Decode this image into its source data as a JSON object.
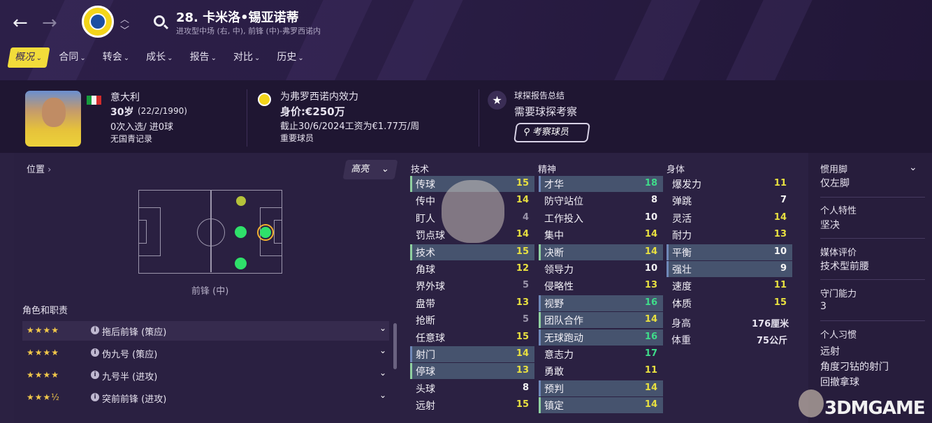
{
  "header": {
    "back_icon": "←",
    "forward_icon": "→",
    "player_number_name": "28. 卡米洛•锡亚诺蒂",
    "player_subtitle": "进攻型中场 (右, 中), 前锋 (中)-弗罗西诺内"
  },
  "tabs": [
    {
      "label": "概况"
    },
    {
      "label": "合同"
    },
    {
      "label": "转会"
    },
    {
      "label": "成长"
    },
    {
      "label": "报告"
    },
    {
      "label": "对比"
    },
    {
      "label": "历史"
    }
  ],
  "profile": {
    "nationality": "意大利",
    "age_label": "30岁",
    "birthdate": "(22/2/1990)",
    "caps": "0次入选/ 进0球",
    "youth_record": "无国青记录",
    "club_line": "为弗罗西诺内效力",
    "value": "身价:€250万",
    "contract": "截止30/6/2024工资为€1.77万/周",
    "squad_status": "重要球员",
    "scout_summary_title": "球探报告总结",
    "scout_summary_text": "需要球探考察",
    "scout_button": "考察球员"
  },
  "position": {
    "label": "位置",
    "highlight_btn": "高亮",
    "position_name": "前锋 (中)",
    "colors": {
      "natural": "#2fe06a",
      "accomplished": "#b5c23a",
      "selected_ring": "#f2b030"
    }
  },
  "roles": {
    "title": "角色和职责",
    "items": [
      {
        "stars": "★★★★",
        "name": "拖后前锋 (策应)"
      },
      {
        "stars": "★★★★",
        "name": "伪九号 (策应)"
      },
      {
        "stars": "★★★★",
        "name": "九号半 (进攻)"
      },
      {
        "stars": "★★★½",
        "name": "突前前锋 (进攻)"
      }
    ]
  },
  "technical": {
    "title": "技术",
    "items": [
      {
        "name": "传球",
        "value": "15"
      },
      {
        "name": "传中",
        "value": "14"
      },
      {
        "name": "盯人",
        "value": "4"
      },
      {
        "name": "罚点球",
        "value": "14"
      },
      {
        "name": "技术",
        "value": "15"
      },
      {
        "name": "角球",
        "value": "12"
      },
      {
        "name": "界外球",
        "value": "5"
      },
      {
        "name": "盘带",
        "value": "13"
      },
      {
        "name": "抢断",
        "value": "5"
      },
      {
        "name": "任意球",
        "value": "15"
      },
      {
        "name": "射门",
        "value": "14"
      },
      {
        "name": "停球",
        "value": "13"
      },
      {
        "name": "头球",
        "value": "8"
      },
      {
        "name": "远射",
        "value": "15"
      }
    ]
  },
  "mental": {
    "title": "精神",
    "items": [
      {
        "name": "才华",
        "value": "18"
      },
      {
        "name": "防守站位",
        "value": "8"
      },
      {
        "name": "工作投入",
        "value": "10"
      },
      {
        "name": "集中",
        "value": "14"
      },
      {
        "name": "决断",
        "value": "14"
      },
      {
        "name": "领导力",
        "value": "10"
      },
      {
        "name": "侵略性",
        "value": "13"
      },
      {
        "name": "视野",
        "value": "16"
      },
      {
        "name": "团队合作",
        "value": "14"
      },
      {
        "name": "无球跑动",
        "value": "16"
      },
      {
        "name": "意志力",
        "value": "17"
      },
      {
        "name": "勇敢",
        "value": "11"
      },
      {
        "name": "预判",
        "value": "14"
      },
      {
        "name": "镇定",
        "value": "14"
      }
    ]
  },
  "physical": {
    "title": "身体",
    "items": [
      {
        "name": "爆发力",
        "value": "11"
      },
      {
        "name": "弹跳",
        "value": "7"
      },
      {
        "name": "灵活",
        "value": "14"
      },
      {
        "name": "耐力",
        "value": "13"
      },
      {
        "name": "平衡",
        "value": "10"
      },
      {
        "name": "强壮",
        "value": "9"
      },
      {
        "name": "速度",
        "value": "11"
      },
      {
        "name": "体质",
        "value": "15"
      }
    ],
    "height_label": "身高",
    "height_value": "176厘米",
    "weight_label": "体重",
    "weight_value": "75公斤"
  },
  "side": {
    "foot_title": "惯用脚",
    "foot_value": "仅左脚",
    "trait_title": "个人特性",
    "trait_value": "坚决",
    "media_title": "媒体评价",
    "media_value": "技术型前腰",
    "gk_title": "守门能力",
    "gk_value": "3",
    "habits_title": "个人习惯",
    "habits": [
      "远射",
      "角度刁钻的射门",
      "回撤拿球"
    ]
  },
  "value_colors": {
    "white": "#f4f4f4",
    "grey": "#9a94aa",
    "yellow": "#e8e040",
    "green": "#3fdc8a"
  },
  "watermark": "3DMGAME"
}
